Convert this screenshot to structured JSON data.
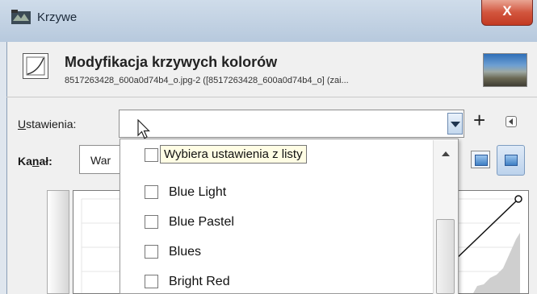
{
  "window": {
    "title": "Krzywe",
    "close_label": "X"
  },
  "header": {
    "title": "Modyfikacja krzywych kolorów",
    "subtitle": "8517263428_600a0d74b4_o.jpg-2 ([8517263428_600a0d74b4_o] (zai..."
  },
  "presets": {
    "label_underlined": "U",
    "label_rest": "stawienia:",
    "value": "",
    "add_label": "+",
    "tooltip": "Wybiera ustawienia z listy",
    "items": [
      {
        "label": ""
      },
      {
        "label": "Blue Light"
      },
      {
        "label": "Blue Pastel"
      },
      {
        "label": "Blues"
      },
      {
        "label": "Bright Red"
      }
    ]
  },
  "channel": {
    "label_a": "Ka",
    "label_underlined": "n",
    "label_b": "ał:",
    "value": "War"
  },
  "icons": {
    "window": "curves-window-icon",
    "header": "curves-tool-icon",
    "dropdown": "chevron-down-icon",
    "menu": "triangle-left-icon",
    "curve_item": "curve-preset-icon"
  }
}
